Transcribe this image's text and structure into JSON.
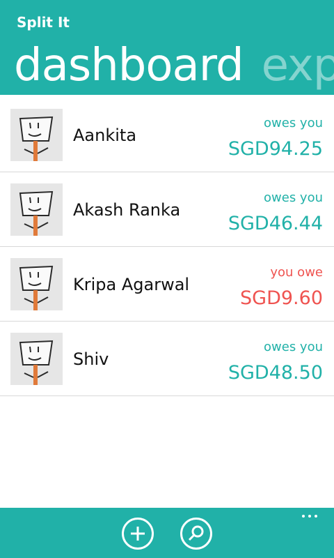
{
  "app": {
    "title": "Split It",
    "pivots": [
      "dashboard",
      "exp"
    ],
    "accent": "#21b1a8"
  },
  "people": [
    {
      "name": "Aankita",
      "status": "owes you",
      "amount": "SGD94.25",
      "tone": "positive"
    },
    {
      "name": "Akash Ranka",
      "status": "owes you",
      "amount": "SGD46.44",
      "tone": "positive"
    },
    {
      "name": "Kripa Agarwal",
      "status": "you owe",
      "amount": "SGD9.60",
      "tone": "negative"
    },
    {
      "name": "Shiv",
      "status": "owes you",
      "amount": "SGD48.50",
      "tone": "positive"
    }
  ],
  "colors": {
    "positive": "#21b1a8",
    "negative": "#ef5350"
  },
  "appbar": {
    "buttons": [
      {
        "icon": "add-icon"
      },
      {
        "icon": "search-icon"
      }
    ],
    "more_icon": "more-icon"
  }
}
